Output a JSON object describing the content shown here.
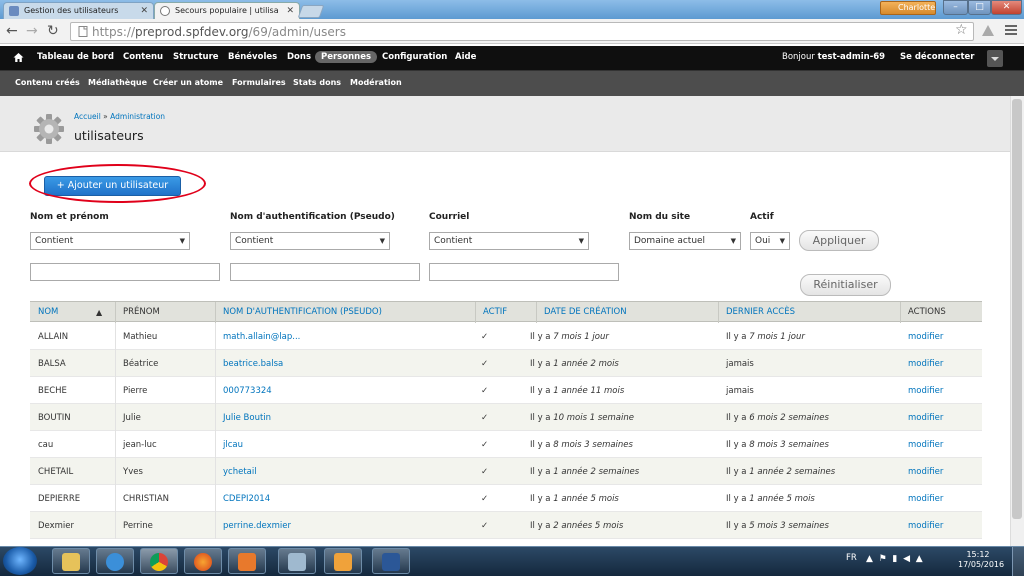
{
  "browser": {
    "tabs": [
      {
        "label": "Gestion des utilisateurs",
        "active": false
      },
      {
        "label": "Secours populaire | utilisa",
        "active": true
      }
    ],
    "user_badge": "Charlotte",
    "url_prefix": "https://",
    "url_host": "preprod.spfdev.org",
    "url_path": "/69/admin/users"
  },
  "admin_menu": {
    "items": [
      "Tableau de bord",
      "Contenu",
      "Structure",
      "Bénévoles",
      "Dons",
      "Personnes",
      "Configuration",
      "Aide"
    ],
    "active": "Personnes",
    "greeting_prefix": "Bonjour ",
    "greeting_user": "test-admin-69",
    "logout": "Se déconnecter"
  },
  "shortcuts": [
    "Contenu créés",
    "Médiathèque",
    "Créer un atome",
    "Formulaires",
    "Stats dons",
    "Modération"
  ],
  "header": {
    "breadcrumb": [
      "Accueil",
      "Administration"
    ],
    "breadcrumb_sep": "»",
    "title": "utilisateurs"
  },
  "add_button": "+ Ajouter un utilisateur",
  "filters": {
    "name_label": "Nom et prénom",
    "name_op": "Contient",
    "pseudo_label": "Nom d'authentification (Pseudo)",
    "pseudo_op": "Contient",
    "mail_label": "Courriel",
    "mail_op": "Contient",
    "site_label": "Nom du site",
    "site_value": "Domaine actuel",
    "active_label": "Actif",
    "active_value": "Oui",
    "apply": "Appliquer",
    "reset": "Réinitialiser"
  },
  "table": {
    "headers": {
      "nom": "NOM",
      "prenom": "PRÉNOM",
      "pseudo": "NOM D'AUTHENTIFICATION (PSEUDO)",
      "actif": "ACTIF",
      "creation": "DATE DE CRÉATION",
      "acces": "DERNIER ACCÈS",
      "actions": "ACTIONS"
    },
    "rows": [
      {
        "nom": "ALLAIN",
        "prenom": "Mathieu",
        "pseudo": "math.allain@lap...",
        "actif": "✓",
        "creation_pre": "Il y a ",
        "creation": "7 mois 1 jour",
        "acces_pre": "Il y a ",
        "acces": "7 mois 1 jour",
        "action": "modifier"
      },
      {
        "nom": "BALSA",
        "prenom": "Béatrice",
        "pseudo": "beatrice.balsa",
        "actif": "✓",
        "creation_pre": "Il y a ",
        "creation": "1 année 2 mois",
        "acces_pre": "",
        "acces": "jamais",
        "action": "modifier"
      },
      {
        "nom": "BECHE",
        "prenom": "Pierre",
        "pseudo": "000773324",
        "actif": "✓",
        "creation_pre": "Il y a ",
        "creation": "1 année 11 mois",
        "acces_pre": "",
        "acces": "jamais",
        "action": "modifier"
      },
      {
        "nom": "BOUTIN",
        "prenom": "Julie",
        "pseudo": "Julie Boutin",
        "actif": "✓",
        "creation_pre": "Il y a ",
        "creation": "10 mois 1 semaine",
        "acces_pre": "Il y a ",
        "acces": "6 mois 2 semaines",
        "action": "modifier"
      },
      {
        "nom": "cau",
        "prenom": "jean-luc",
        "pseudo": "jlcau",
        "actif": "✓",
        "creation_pre": "Il y a ",
        "creation": "8 mois 3 semaines",
        "acces_pre": "Il y a ",
        "acces": "8 mois 3 semaines",
        "action": "modifier"
      },
      {
        "nom": "CHETAIL",
        "prenom": "Yves",
        "pseudo": "ychetail",
        "actif": "✓",
        "creation_pre": "Il y a ",
        "creation": "1 année 2 semaines",
        "acces_pre": "Il y a ",
        "acces": "1 année 2 semaines",
        "action": "modifier"
      },
      {
        "nom": "DEPIERRE",
        "prenom": "CHRISTIAN",
        "pseudo": "CDEPI2014",
        "actif": "✓",
        "creation_pre": "Il y a ",
        "creation": "1 année 5 mois",
        "acces_pre": "Il y a ",
        "acces": "1 année 5 mois",
        "action": "modifier"
      },
      {
        "nom": "Dexmier",
        "prenom": "Perrine",
        "pseudo": "perrine.dexmier",
        "actif": "✓",
        "creation_pre": "Il y a ",
        "creation": "2 années 5 mois",
        "acces_pre": "Il y a ",
        "acces": "5 mois 3 semaines",
        "action": "modifier"
      }
    ]
  },
  "taskbar": {
    "lang": "FR",
    "time": "15:12",
    "date": "17/05/2016"
  },
  "colors": {
    "link": "#0074bd",
    "admin_bar": "#0f0f0f",
    "button_blue": "#2a86d8",
    "annotation": "#e0001a"
  }
}
